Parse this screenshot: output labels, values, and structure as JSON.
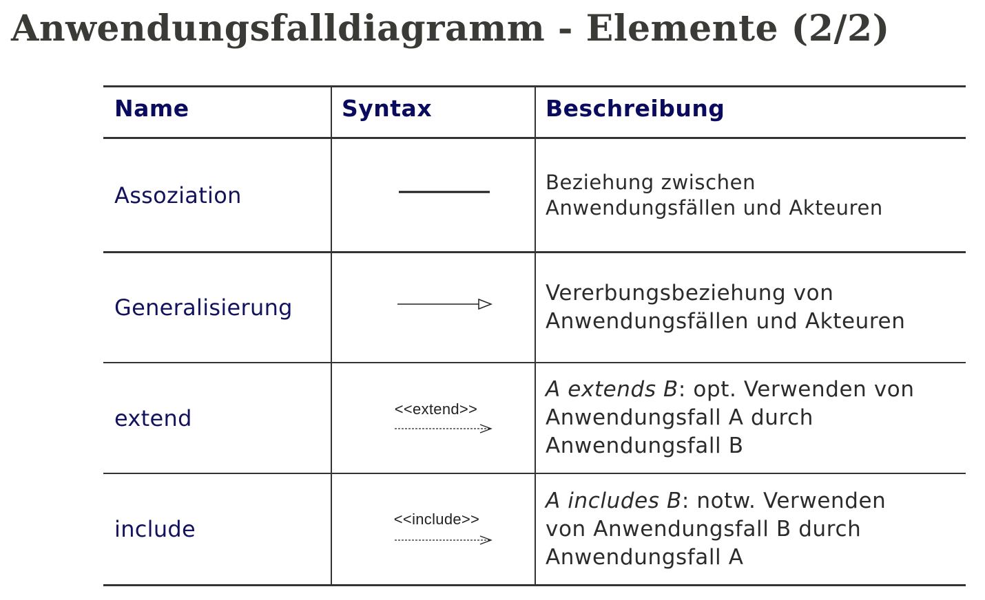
{
  "title": "Anwendungsfalldiagramm - Elemente (2/2)",
  "table": {
    "headers": {
      "name": "Name",
      "syntax": "Syntax",
      "description": "Beschreibung"
    },
    "rows": [
      {
        "name": "Assoziation",
        "syntax_icon": "solid-line-icon",
        "description_lines": [
          "Beziehung zwischen",
          "Anwendungsfällen und Akteuren"
        ]
      },
      {
        "name": "Generalisierung",
        "syntax_icon": "hollow-triangle-arrow-icon",
        "description_lines": [
          "Vererbungsbeziehung von",
          "Anwendungsfällen und Akteuren"
        ]
      },
      {
        "name": "extend",
        "syntax_label": "<<extend>>",
        "syntax_icon": "dashed-open-arrow-icon",
        "description_italic": "A extends B",
        "description_rest": ": opt. Verwenden von",
        "description_lines": [
          "Anwendungsfall A durch",
          "Anwendungsfall B"
        ]
      },
      {
        "name": "include",
        "syntax_label": "<<include>>",
        "syntax_icon": "dashed-open-arrow-icon",
        "description_italic": "A includes B",
        "description_rest": ": notw. Verwenden",
        "description_lines": [
          "von Anwendungsfall B durch",
          "Anwendungsfall A"
        ]
      }
    ]
  }
}
